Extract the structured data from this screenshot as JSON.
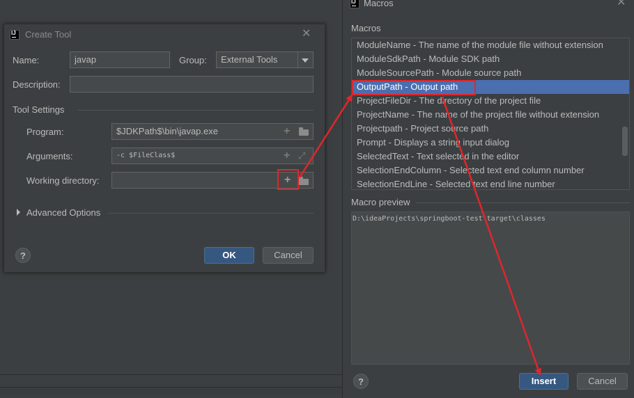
{
  "create_tool": {
    "title": "Create Tool",
    "logo_text": "IJ",
    "name_label": "Name:",
    "name_value": "javap",
    "group_label": "Group:",
    "group_value": "External Tools",
    "description_label": "Description:",
    "description_value": "",
    "section_title": "Tool Settings",
    "program_label": "Program:",
    "program_value": "$JDKPath$\\bin\\javap.exe",
    "arguments_label": "Arguments:",
    "arguments_value": "-c $FileClass$",
    "working_dir_label": "Working directory:",
    "working_dir_value": "",
    "advanced_label": "Advanced Options",
    "help_label": "?",
    "ok_label": "OK",
    "cancel_label": "Cancel"
  },
  "macros": {
    "title": "Macros",
    "logo_text": "IJ",
    "section_title": "Macros",
    "items": [
      "ModuleName - The name of the module file without extension",
      "ModuleSdkPath - Module SDK path",
      "ModuleSourcePath - Module source path",
      "OutputPath - Output path",
      "ProjectFileDir - The directory of the project file",
      "ProjectName - The name of the project file without extension",
      "Projectpath - Project source path",
      "Prompt - Displays a string input dialog",
      "SelectedText - Text selected in the editor",
      "SelectionEndColumn - Selected text end column number",
      "SelectionEndLine - Selected text end line number"
    ],
    "selected_item": "OutputPath - Output path",
    "preview_title": "Macro preview",
    "preview_text": "D:\\ideaProjects\\springboot-test\\target\\classes",
    "help_label": "?",
    "insert_label": "Insert",
    "cancel_label": "Cancel"
  },
  "colors": {
    "background": "#3c3f41",
    "selection": "#4b6eaf",
    "default_button": "#365880",
    "annotation_red": "#e0262b"
  }
}
